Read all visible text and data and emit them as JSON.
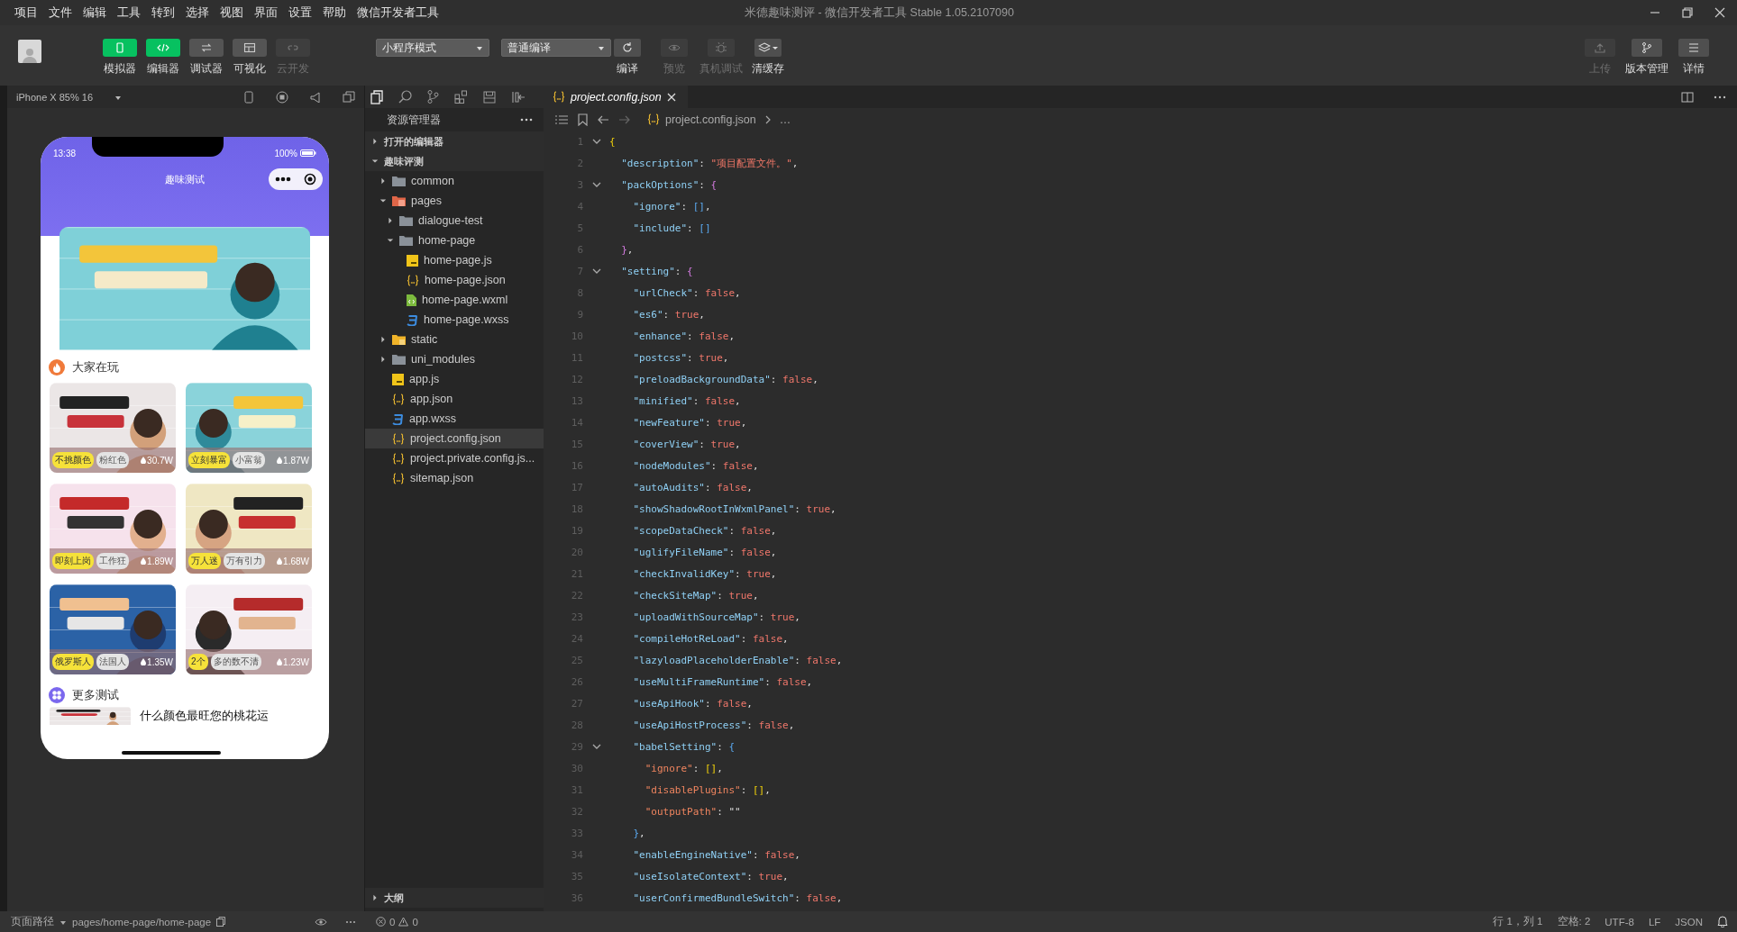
{
  "menu_bar": {
    "items": [
      "项目",
      "文件",
      "编辑",
      "工具",
      "转到",
      "选择",
      "视图",
      "界面",
      "设置",
      "帮助",
      "微信开发者工具"
    ],
    "title": "米德趣味测评 - 微信开发者工具 Stable 1.05.2107090"
  },
  "toolbar": {
    "view_buttons": [
      {
        "label": "模拟器",
        "selected": true,
        "disabled": false
      },
      {
        "label": "编辑器",
        "selected": true,
        "disabled": false
      },
      {
        "label": "调试器",
        "selected": false,
        "disabled": false
      },
      {
        "label": "可视化",
        "selected": false,
        "disabled": false
      },
      {
        "label": "云开发",
        "selected": false,
        "disabled": true
      }
    ],
    "mode_select": "小程序模式",
    "compile_select": "普通编译",
    "actions": [
      {
        "label": "编译",
        "disabled": false
      },
      {
        "label": "预览",
        "disabled": true
      },
      {
        "label": "真机调试",
        "disabled": true
      },
      {
        "label": "清缓存",
        "disabled": false
      }
    ],
    "right_actions": [
      {
        "label": "上传",
        "disabled": true
      },
      {
        "label": "版本管理",
        "disabled": false
      },
      {
        "label": "详情",
        "disabled": false
      }
    ]
  },
  "simulator": {
    "device": "iPhone X 85% 16",
    "status_time": "13:38",
    "battery": "100%",
    "nav_title": "趣味测试",
    "popular_title": "大家在玩",
    "cards": [
      {
        "tags": [
          {
            "label": "不挑颜色",
            "kind": "highlight"
          },
          {
            "label": "粉红色",
            "kind": "plain"
          }
        ],
        "count": "30.7W"
      },
      {
        "tags": [
          {
            "label": "立刻暴富",
            "kind": "highlight"
          },
          {
            "label": "小富翁",
            "kind": "plain"
          }
        ],
        "count": "1.87W"
      },
      {
        "tags": [
          {
            "label": "即刻上岗",
            "kind": "highlight"
          },
          {
            "label": "工作狂",
            "kind": "plain"
          }
        ],
        "count": "1.89W"
      },
      {
        "tags": [
          {
            "label": "万人迷",
            "kind": "highlight"
          },
          {
            "label": "万有引力",
            "kind": "plain"
          }
        ],
        "count": "1.68W"
      },
      {
        "tags": [
          {
            "label": "俄罗斯人",
            "kind": "highlight"
          },
          {
            "label": "法国人",
            "kind": "plain"
          }
        ],
        "count": "1.35W"
      },
      {
        "tags": [
          {
            "label": "2个",
            "kind": "highlight"
          },
          {
            "label": "多的数不清",
            "kind": "plain"
          }
        ],
        "count": "1.23W"
      }
    ],
    "more_title": "更多测试",
    "more_items": [
      "什么颜色最旺您的桃花运"
    ]
  },
  "explorer": {
    "title": "资源管理器",
    "sections": [
      {
        "label": "打开的编辑器",
        "expanded": false
      },
      {
        "label": "趣味评测",
        "expanded": true
      }
    ],
    "tree": [
      {
        "label": "common",
        "kind": "folder",
        "expanded": false,
        "selected": false
      },
      {
        "label": "pages",
        "kind": "pages-folder",
        "expanded": true,
        "selected": false,
        "children": [
          {
            "label": "dialogue-test",
            "kind": "folder",
            "expanded": false,
            "selected": false
          },
          {
            "label": "home-page",
            "kind": "folder",
            "expanded": true,
            "selected": false,
            "children": [
              {
                "label": "home-page.js",
                "kind": "js",
                "selected": false
              },
              {
                "label": "home-page.json",
                "kind": "json",
                "selected": false
              },
              {
                "label": "home-page.wxml",
                "kind": "wxml",
                "selected": false
              },
              {
                "label": "home-page.wxss",
                "kind": "wxss",
                "selected": false
              }
            ]
          }
        ]
      },
      {
        "label": "static",
        "kind": "asset-folder",
        "expanded": false,
        "selected": false
      },
      {
        "label": "uni_modules",
        "kind": "folder",
        "expanded": false,
        "selected": false
      },
      {
        "label": "app.js",
        "kind": "js",
        "selected": false
      },
      {
        "label": "app.json",
        "kind": "json",
        "selected": false
      },
      {
        "label": "app.wxss",
        "kind": "wxss",
        "selected": false
      },
      {
        "label": "project.config.json",
        "kind": "json",
        "selected": true
      },
      {
        "label": "project.private.config.js...",
        "kind": "json",
        "selected": false
      },
      {
        "label": "sitemap.json",
        "kind": "json",
        "selected": false
      }
    ],
    "outline": {
      "label": "大纲",
      "expanded": false
    }
  },
  "editor": {
    "tabs": [
      {
        "label": "project.config.json",
        "selected": true
      }
    ],
    "breadcrumb": [
      "project.config.json",
      "…"
    ],
    "lines": [
      {
        "number": "1",
        "fold": true,
        "tokens": [
          {
            "kind": "brace1",
            "text": "{"
          }
        ],
        "children": [
          {
            "number": "2",
            "fold": false,
            "tokens": [
              {
                "kind": "key",
                "text": "\"description\""
              },
              {
                "kind": "punct",
                "text": ": "
              },
              {
                "kind": "string",
                "text": "\"项目配置文件。\""
              },
              {
                "kind": "punct",
                "text": ","
              }
            ]
          },
          {
            "number": "3",
            "fold": true,
            "tokens": [
              {
                "kind": "key",
                "text": "\"packOptions\""
              },
              {
                "kind": "punct",
                "text": ": "
              },
              {
                "kind": "brace2",
                "text": "{"
              }
            ],
            "children": [
              {
                "number": "4",
                "fold": false,
                "tokens": [
                  {
                    "kind": "key",
                    "text": "\"ignore\""
                  },
                  {
                    "kind": "punct",
                    "text": ": "
                  },
                  {
                    "kind": "brace3",
                    "text": "[]"
                  },
                  {
                    "kind": "punct",
                    "text": ","
                  }
                ]
              },
              {
                "number": "5",
                "fold": false,
                "tokens": [
                  {
                    "kind": "key",
                    "text": "\"include\""
                  },
                  {
                    "kind": "punct",
                    "text": ": "
                  },
                  {
                    "kind": "brace3",
                    "text": "[]"
                  }
                ]
              }
            ]
          },
          {
            "number": "6",
            "fold": false,
            "tokens": [
              {
                "kind": "brace2",
                "text": "}"
              },
              {
                "kind": "punct",
                "text": ","
              }
            ]
          },
          {
            "number": "7",
            "fold": true,
            "tokens": [
              {
                "kind": "key",
                "text": "\"setting\""
              },
              {
                "kind": "punct",
                "text": ": "
              },
              {
                "kind": "brace2",
                "text": "{"
              }
            ],
            "children": [
              {
                "number": "8",
                "fold": false,
                "tokens": [
                  {
                    "kind": "key",
                    "text": "\"urlCheck\""
                  },
                  {
                    "kind": "punct",
                    "text": ": "
                  },
                  {
                    "kind": "bool",
                    "text": "false"
                  },
                  {
                    "kind": "punct",
                    "text": ","
                  }
                ]
              },
              {
                "number": "9",
                "fold": false,
                "tokens": [
                  {
                    "kind": "key",
                    "text": "\"es6\""
                  },
                  {
                    "kind": "punct",
                    "text": ": "
                  },
                  {
                    "kind": "bool",
                    "text": "true"
                  },
                  {
                    "kind": "punct",
                    "text": ","
                  }
                ]
              },
              {
                "number": "10",
                "fold": false,
                "tokens": [
                  {
                    "kind": "key",
                    "text": "\"enhance\""
                  },
                  {
                    "kind": "punct",
                    "text": ": "
                  },
                  {
                    "kind": "bool",
                    "text": "false"
                  },
                  {
                    "kind": "punct",
                    "text": ","
                  }
                ]
              },
              {
                "number": "11",
                "fold": false,
                "tokens": [
                  {
                    "kind": "key",
                    "text": "\"postcss\""
                  },
                  {
                    "kind": "punct",
                    "text": ": "
                  },
                  {
                    "kind": "bool",
                    "text": "true"
                  },
                  {
                    "kind": "punct",
                    "text": ","
                  }
                ]
              },
              {
                "number": "12",
                "fold": false,
                "tokens": [
                  {
                    "kind": "key",
                    "text": "\"preloadBackgroundData\""
                  },
                  {
                    "kind": "punct",
                    "text": ": "
                  },
                  {
                    "kind": "bool",
                    "text": "false"
                  },
                  {
                    "kind": "punct",
                    "text": ","
                  }
                ]
              },
              {
                "number": "13",
                "fold": false,
                "tokens": [
                  {
                    "kind": "key",
                    "text": "\"minified\""
                  },
                  {
                    "kind": "punct",
                    "text": ": "
                  },
                  {
                    "kind": "bool",
                    "text": "false"
                  },
                  {
                    "kind": "punct",
                    "text": ","
                  }
                ]
              },
              {
                "number": "14",
                "fold": false,
                "tokens": [
                  {
                    "kind": "key",
                    "text": "\"newFeature\""
                  },
                  {
                    "kind": "punct",
                    "text": ": "
                  },
                  {
                    "kind": "bool",
                    "text": "true"
                  },
                  {
                    "kind": "punct",
                    "text": ","
                  }
                ]
              },
              {
                "number": "15",
                "fold": false,
                "tokens": [
                  {
                    "kind": "key",
                    "text": "\"coverView\""
                  },
                  {
                    "kind": "punct",
                    "text": ": "
                  },
                  {
                    "kind": "bool",
                    "text": "true"
                  },
                  {
                    "kind": "punct",
                    "text": ","
                  }
                ]
              },
              {
                "number": "16",
                "fold": false,
                "tokens": [
                  {
                    "kind": "key",
                    "text": "\"nodeModules\""
                  },
                  {
                    "kind": "punct",
                    "text": ": "
                  },
                  {
                    "kind": "bool",
                    "text": "false"
                  },
                  {
                    "kind": "punct",
                    "text": ","
                  }
                ]
              },
              {
                "number": "17",
                "fold": false,
                "tokens": [
                  {
                    "kind": "key",
                    "text": "\"autoAudits\""
                  },
                  {
                    "kind": "punct",
                    "text": ": "
                  },
                  {
                    "kind": "bool",
                    "text": "false"
                  },
                  {
                    "kind": "punct",
                    "text": ","
                  }
                ]
              },
              {
                "number": "18",
                "fold": false,
                "tokens": [
                  {
                    "kind": "key",
                    "text": "\"showShadowRootInWxmlPanel\""
                  },
                  {
                    "kind": "punct",
                    "text": ": "
                  },
                  {
                    "kind": "bool",
                    "text": "true"
                  },
                  {
                    "kind": "punct",
                    "text": ","
                  }
                ]
              },
              {
                "number": "19",
                "fold": false,
                "tokens": [
                  {
                    "kind": "key",
                    "text": "\"scopeDataCheck\""
                  },
                  {
                    "kind": "punct",
                    "text": ": "
                  },
                  {
                    "kind": "bool",
                    "text": "false"
                  },
                  {
                    "kind": "punct",
                    "text": ","
                  }
                ]
              },
              {
                "number": "20",
                "fold": false,
                "tokens": [
                  {
                    "kind": "key",
                    "text": "\"uglifyFileName\""
                  },
                  {
                    "kind": "punct",
                    "text": ": "
                  },
                  {
                    "kind": "bool",
                    "text": "false"
                  },
                  {
                    "kind": "punct",
                    "text": ","
                  }
                ]
              },
              {
                "number": "21",
                "fold": false,
                "tokens": [
                  {
                    "kind": "key",
                    "text": "\"checkInvalidKey\""
                  },
                  {
                    "kind": "punct",
                    "text": ": "
                  },
                  {
                    "kind": "bool",
                    "text": "true"
                  },
                  {
                    "kind": "punct",
                    "text": ","
                  }
                ]
              },
              {
                "number": "22",
                "fold": false,
                "tokens": [
                  {
                    "kind": "key",
                    "text": "\"checkSiteMap\""
                  },
                  {
                    "kind": "punct",
                    "text": ": "
                  },
                  {
                    "kind": "bool",
                    "text": "true"
                  },
                  {
                    "kind": "punct",
                    "text": ","
                  }
                ]
              },
              {
                "number": "23",
                "fold": false,
                "tokens": [
                  {
                    "kind": "key",
                    "text": "\"uploadWithSourceMap\""
                  },
                  {
                    "kind": "punct",
                    "text": ": "
                  },
                  {
                    "kind": "bool",
                    "text": "true"
                  },
                  {
                    "kind": "punct",
                    "text": ","
                  }
                ]
              },
              {
                "number": "24",
                "fold": false,
                "tokens": [
                  {
                    "kind": "key",
                    "text": "\"compileHotReLoad\""
                  },
                  {
                    "kind": "punct",
                    "text": ": "
                  },
                  {
                    "kind": "bool",
                    "text": "false"
                  },
                  {
                    "kind": "punct",
                    "text": ","
                  }
                ]
              },
              {
                "number": "25",
                "fold": false,
                "tokens": [
                  {
                    "kind": "key",
                    "text": "\"lazyloadPlaceholderEnable\""
                  },
                  {
                    "kind": "punct",
                    "text": ": "
                  },
                  {
                    "kind": "bool",
                    "text": "false"
                  },
                  {
                    "kind": "punct",
                    "text": ","
                  }
                ]
              },
              {
                "number": "26",
                "fold": false,
                "tokens": [
                  {
                    "kind": "key",
                    "text": "\"useMultiFrameRuntime\""
                  },
                  {
                    "kind": "punct",
                    "text": ": "
                  },
                  {
                    "kind": "bool",
                    "text": "false"
                  },
                  {
                    "kind": "punct",
                    "text": ","
                  }
                ]
              },
              {
                "number": "27",
                "fold": false,
                "tokens": [
                  {
                    "kind": "key",
                    "text": "\"useApiHook\""
                  },
                  {
                    "kind": "punct",
                    "text": ": "
                  },
                  {
                    "kind": "bool",
                    "text": "false"
                  },
                  {
                    "kind": "punct",
                    "text": ","
                  }
                ]
              },
              {
                "number": "28",
                "fold": false,
                "tokens": [
                  {
                    "kind": "key",
                    "text": "\"useApiHostProcess\""
                  },
                  {
                    "kind": "punct",
                    "text": ": "
                  },
                  {
                    "kind": "bool",
                    "text": "false"
                  },
                  {
                    "kind": "punct",
                    "text": ","
                  }
                ]
              },
              {
                "number": "29",
                "fold": true,
                "tokens": [
                  {
                    "kind": "key",
                    "text": "\"babelSetting\""
                  },
                  {
                    "kind": "punct",
                    "text": ": "
                  },
                  {
                    "kind": "brace3",
                    "text": "{"
                  }
                ],
                "children": [
                  {
                    "number": "30",
                    "fold": false,
                    "tokens": [
                      {
                        "kind": "key2",
                        "text": "\"ignore\""
                      },
                      {
                        "kind": "punct",
                        "text": ": "
                      },
                      {
                        "kind": "brace1",
                        "text": "[]"
                      },
                      {
                        "kind": "punct",
                        "text": ","
                      }
                    ]
                  },
                  {
                    "number": "31",
                    "fold": false,
                    "tokens": [
                      {
                        "kind": "key2",
                        "text": "\"disablePlugins\""
                      },
                      {
                        "kind": "punct",
                        "text": ": "
                      },
                      {
                        "kind": "brace1",
                        "text": "[]"
                      },
                      {
                        "kind": "punct",
                        "text": ","
                      }
                    ]
                  },
                  {
                    "number": "32",
                    "fold": false,
                    "tokens": [
                      {
                        "kind": "key2",
                        "text": "\"outputPath\""
                      },
                      {
                        "kind": "punct",
                        "text": ": \"\""
                      }
                    ]
                  }
                ]
              },
              {
                "number": "33",
                "fold": false,
                "tokens": [
                  {
                    "kind": "brace3",
                    "text": "}"
                  },
                  {
                    "kind": "punct",
                    "text": ","
                  }
                ]
              },
              {
                "number": "34",
                "fold": false,
                "tokens": [
                  {
                    "kind": "key",
                    "text": "\"enableEngineNative\""
                  },
                  {
                    "kind": "punct",
                    "text": ": "
                  },
                  {
                    "kind": "bool",
                    "text": "false"
                  },
                  {
                    "kind": "punct",
                    "text": ","
                  }
                ]
              },
              {
                "number": "35",
                "fold": false,
                "tokens": [
                  {
                    "kind": "key",
                    "text": "\"useIsolateContext\""
                  },
                  {
                    "kind": "punct",
                    "text": ": "
                  },
                  {
                    "kind": "bool",
                    "text": "true"
                  },
                  {
                    "kind": "punct",
                    "text": ","
                  }
                ]
              },
              {
                "number": "36",
                "fold": false,
                "tokens": [
                  {
                    "kind": "key",
                    "text": "\"userConfirmedBundleSwitch\""
                  },
                  {
                    "kind": "punct",
                    "text": ": "
                  },
                  {
                    "kind": "bool",
                    "text": "false"
                  },
                  {
                    "kind": "punct",
                    "text": ","
                  }
                ]
              }
            ]
          }
        ]
      }
    ]
  },
  "status_bar": {
    "page_path_label": "页面路径",
    "page_path": "pages/home-page/home-page",
    "errors": "0",
    "warnings": "0",
    "right": [
      "行 1，列 1",
      "空格: 2",
      "UTF-8",
      "LF",
      "JSON"
    ]
  }
}
